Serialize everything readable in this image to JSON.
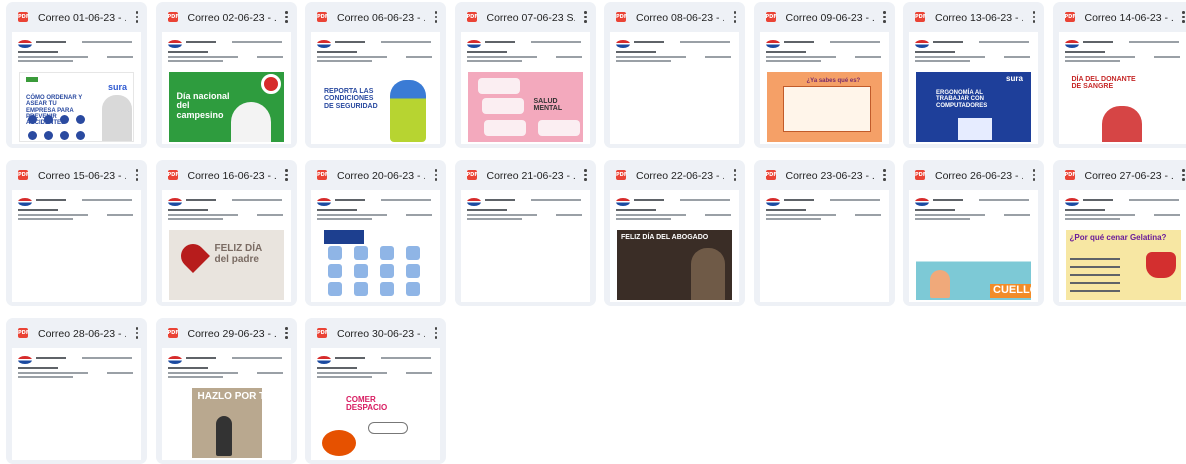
{
  "files": [
    {
      "title": "Correo 01-06-23 - ...",
      "art": {
        "kind": "sura",
        "bg": "#ffffff",
        "text": "CÓMO ORDENAR Y ASEAR TU EMPRESA PARA PREVENIR ACCIDENTES",
        "brand": "sura"
      }
    },
    {
      "title": "Correo 02-06-23 - ...",
      "art": {
        "kind": "green",
        "bg": "#2e9c3e",
        "text": "Día nacional del campesino"
      }
    },
    {
      "title": "Correo 06-06-23 - ...",
      "art": {
        "kind": "safety",
        "bg": "#ffffff",
        "text": "REPORTA LAS CONDICIONES DE SEGURIDAD"
      }
    },
    {
      "title": "Correo 07-06-23 S...",
      "art": {
        "kind": "pink",
        "bg": "#f3a9bd",
        "text": "SALUD MENTAL"
      }
    },
    {
      "title": "Correo 08-06-23 - ...",
      "art": {
        "kind": "blank",
        "bg": "#ffffff",
        "text": ""
      }
    },
    {
      "title": "Correo 09-06-23 - ...",
      "art": {
        "kind": "orange",
        "bg": "#f5a067",
        "text": "¿Ya sabes qué es?"
      }
    },
    {
      "title": "Correo 13-06-23 - ...",
      "art": {
        "kind": "blue",
        "bg": "#1e3f9a",
        "text": "ERGONOMÍA AL TRABAJAR CON COMPUTADORES",
        "brand": "sura"
      }
    },
    {
      "title": "Correo 14-06-23 - ...",
      "art": {
        "kind": "blood",
        "bg": "#ffffff",
        "text": "DÍA DEL DONANTE DE SANGRE"
      }
    },
    {
      "title": "Correo 15-06-23 - ...",
      "art": {
        "kind": "blank",
        "bg": "#ffffff",
        "text": ""
      }
    },
    {
      "title": "Correo 16-06-23 - ...",
      "art": {
        "kind": "father",
        "bg": "#e9e4de",
        "text": "FELIZ DÍA del padre"
      }
    },
    {
      "title": "Correo 20-06-23 - ...",
      "art": {
        "kind": "exercise",
        "bg": "#ffffff",
        "text": ""
      }
    },
    {
      "title": "Correo 21-06-23 - ...",
      "art": {
        "kind": "blank",
        "bg": "#ffffff",
        "text": ""
      }
    },
    {
      "title": "Correo 22-06-23 - ...",
      "art": {
        "kind": "lawyer",
        "bg": "#3a2d26",
        "text": "FELIZ DÍA DEL ABOGADO"
      }
    },
    {
      "title": "Correo 23-06-23 - ...",
      "art": {
        "kind": "blank",
        "bg": "#ffffff",
        "text": ""
      }
    },
    {
      "title": "Correo 26-06-23 - ...",
      "art": {
        "kind": "neck",
        "bg": "#7dc9d6",
        "text": "CUELLO"
      }
    },
    {
      "title": "Correo 27-06-23 - ...",
      "art": {
        "kind": "gelatin",
        "bg": "#f7e7a3",
        "text": "¿Por qué cenar Gelatina?"
      }
    },
    {
      "title": "Correo 28-06-23 - ...",
      "art": {
        "kind": "blank",
        "bg": "#ffffff",
        "text": ""
      }
    },
    {
      "title": "Correo 29-06-23 - ...",
      "art": {
        "kind": "hazlo",
        "bg": "#b9a88f",
        "text": "HAZLO POR TI"
      }
    },
    {
      "title": "Correo 30-06-23 - ...",
      "art": {
        "kind": "eat",
        "bg": "#ffffff",
        "text": "COMER DESPACIO"
      }
    }
  ],
  "icons": {
    "file_type": "pdf-icon",
    "menu": "more-vert-icon"
  },
  "pdf_label": "PDF",
  "colors": {
    "card_bg": "#eef1f6",
    "pdf_red": "#ea4335"
  }
}
